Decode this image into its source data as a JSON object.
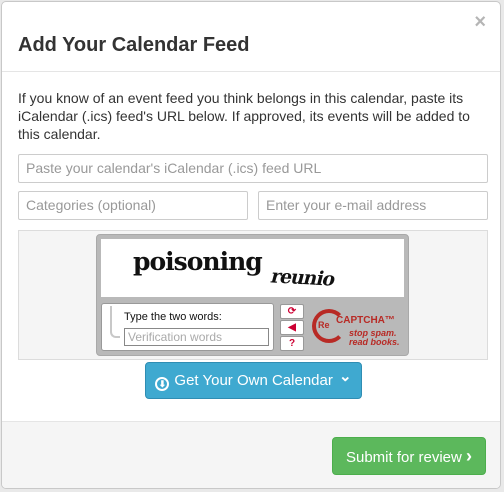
{
  "dialog": {
    "title": "Add Your Calendar Feed",
    "close_glyph": "×",
    "intro": "If you know of an event feed you think belongs in this calendar, paste its iCalendar (.ics) feed's URL below. If approved, its events will be added to this calendar."
  },
  "form": {
    "feed_url_placeholder": "Paste your calendar's iCalendar (.ics) feed URL",
    "categories_placeholder": "Categories (optional)",
    "email_placeholder": "Enter your e-mail address"
  },
  "captcha": {
    "word1": "poisoning",
    "word2": "reunio",
    "prompt": "Type the two words:",
    "input_placeholder": "Verification words",
    "brand_re": "Re",
    "brand_name": "CAPTCHA™",
    "tagline_1": "stop spam.",
    "tagline_2": "read books.",
    "controls": [
      {
        "name": "refresh-icon",
        "glyph": "⟳"
      },
      {
        "name": "audio-icon",
        "glyph": "◀"
      },
      {
        "name": "help-icon",
        "glyph": "?"
      }
    ],
    "brand_color": "#b82a25"
  },
  "buttons": {
    "get_own_calendar": "Get Your Own Calendar",
    "get_own_icon": "⬇",
    "get_own_chevron": "⌄",
    "submit": "Submit for review",
    "submit_chevron": "›"
  },
  "colors": {
    "info_button": "#3fa9d0",
    "success_button": "#5cb85c"
  }
}
